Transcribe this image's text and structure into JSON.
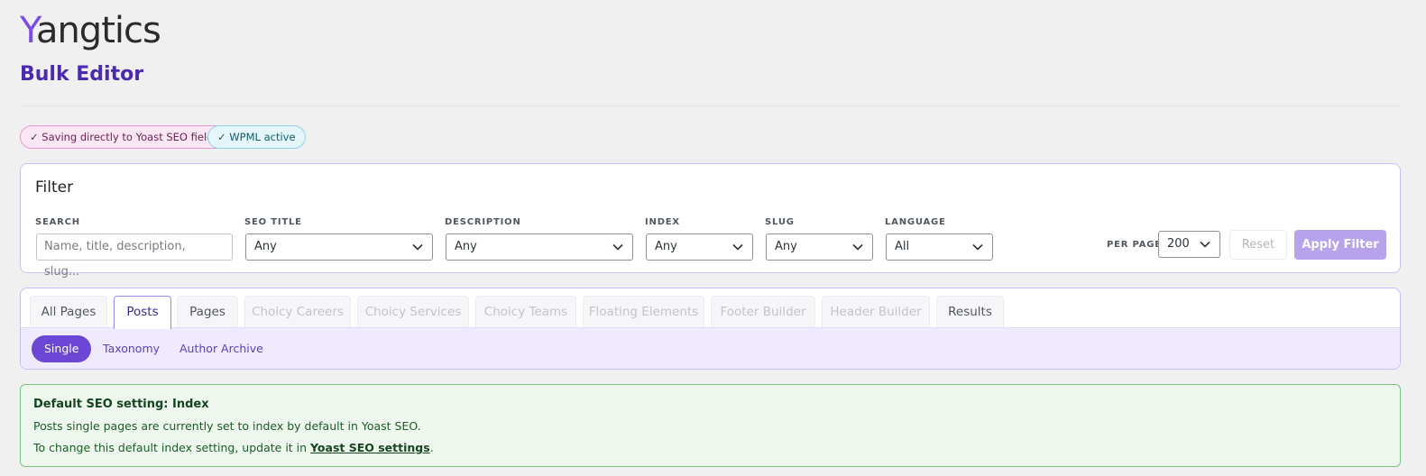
{
  "brand": {
    "logo_first": "Y",
    "logo_rest": "angtics"
  },
  "page": {
    "title": "Bulk Editor"
  },
  "badges": [
    {
      "text": "✓ Saving directly to Yoast SEO fields"
    },
    {
      "text": "✓ WPML active"
    }
  ],
  "filter": {
    "title": "Filter",
    "search": {
      "label": "SEARCH",
      "placeholder": "Name, title, description, slug..."
    },
    "seo_title": {
      "label": "SEO TITLE",
      "value": "Any"
    },
    "description": {
      "label": "DESCRIPTION",
      "value": "Any"
    },
    "index": {
      "label": "INDEX",
      "value": "Any"
    },
    "slug": {
      "label": "SLUG",
      "value": "Any"
    },
    "language": {
      "label": "LANGUAGE",
      "value": "All"
    },
    "per_page": {
      "label": "PER PAGE",
      "value": "200"
    },
    "reset_label": "Reset",
    "apply_label": "Apply Filter"
  },
  "tabs": [
    {
      "label": "All Pages",
      "state": "enabled"
    },
    {
      "label": "Posts",
      "state": "active"
    },
    {
      "label": "Pages",
      "state": "enabled"
    },
    {
      "label": "Choicy Careers",
      "state": "disabled"
    },
    {
      "label": "Choicy Services",
      "state": "disabled"
    },
    {
      "label": "Choicy Teams",
      "state": "disabled"
    },
    {
      "label": "Floating Elements",
      "state": "disabled"
    },
    {
      "label": "Footer Builder",
      "state": "disabled"
    },
    {
      "label": "Header Builder",
      "state": "disabled"
    },
    {
      "label": "Results",
      "state": "enabled"
    }
  ],
  "subtabs": [
    {
      "label": "Single",
      "active": true
    },
    {
      "label": "Taxonomy",
      "active": false
    },
    {
      "label": "Author Archive",
      "active": false
    }
  ],
  "notice": {
    "title": "Default SEO setting: Index",
    "line1": "Posts single pages are currently set to index by default in Yoast SEO.",
    "line2_prefix": "To change this default index setting, update it in ",
    "line2_link": "Yoast SEO settings",
    "line2_suffix": "."
  },
  "colors": {
    "accent": "#6c47d6",
    "title": "#4b2ab0",
    "apply_button": "#b6a3ec",
    "notice_border": "#7cc282"
  }
}
